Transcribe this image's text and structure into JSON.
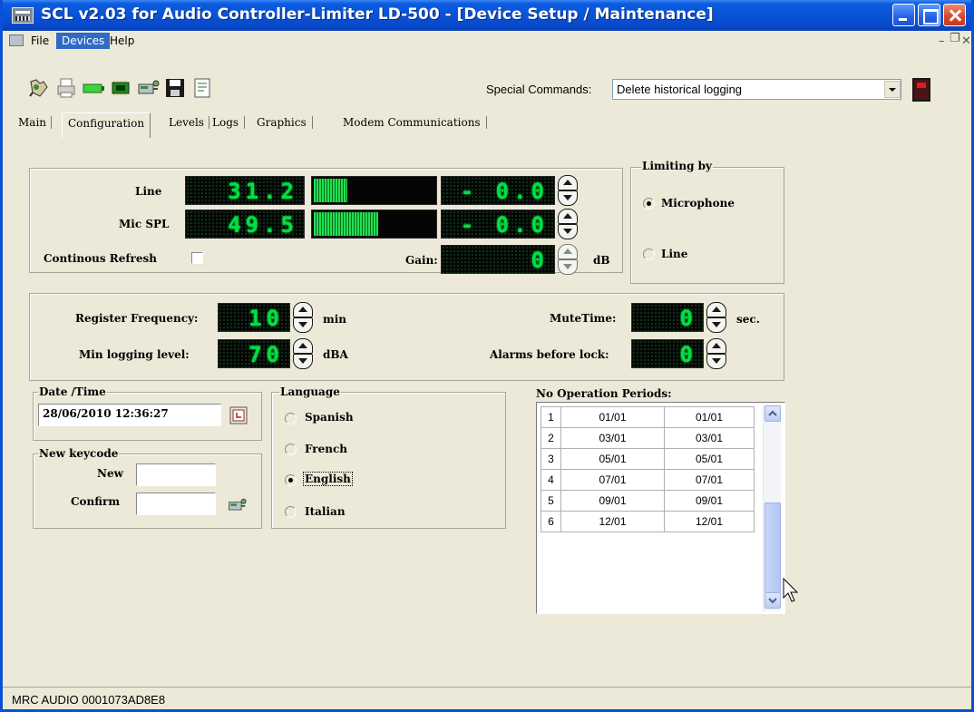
{
  "window": {
    "title": "SCL v2.03 for Audio Controller-Limiter LD-500 - [Device Setup / Maintenance]"
  },
  "menu": {
    "items": [
      "File",
      "Devices",
      "Help"
    ],
    "active": "Devices"
  },
  "toolbar": {
    "special_commands_label": "Special Commands:",
    "special_commands_value": "Delete historical logging",
    "icons": [
      "connect-icon",
      "print-icon",
      "battery-icon",
      "chip-icon",
      "device-icon",
      "save-icon",
      "document-icon"
    ]
  },
  "tabs": [
    "Main",
    "Configuration",
    "Levels",
    "Logs",
    "Graphics",
    "Modem Communications"
  ],
  "active_tab": "Configuration",
  "levels": {
    "line_label": "Line",
    "line_value": "31.2",
    "line_bar_fraction": 0.3,
    "line_offset": "- 0.0",
    "mic_label": "Mic SPL",
    "mic_value": "49.5",
    "mic_bar_fraction": 0.55,
    "mic_offset": "- 0.0",
    "refresh_label": "Continous Refresh",
    "refresh_checked": false,
    "gain_label": "Gain:",
    "gain_value": "0",
    "gain_unit": "dB"
  },
  "limiting": {
    "title": "Limiting by",
    "options": [
      "Microphone",
      "Line"
    ],
    "selected": "Microphone"
  },
  "logging": {
    "register_freq_label": "Register Frequency:",
    "register_freq_value": "10",
    "register_freq_unit": "min",
    "min_level_label": "Min logging level:",
    "min_level_value": "70",
    "min_level_unit": "dBA",
    "mute_time_label": "MuteTime:",
    "mute_time_value": "0",
    "mute_time_unit": "sec.",
    "alarms_label": "Alarms before lock:",
    "alarms_value": "0"
  },
  "datetime": {
    "title": "Date /Time",
    "value": "28/06/2010 12:36:27"
  },
  "keycode": {
    "title": "New keycode",
    "new_label": "New",
    "confirm_label": "Confirm"
  },
  "language": {
    "title": "Language",
    "options": [
      "Spanish",
      "French",
      "English",
      "Italian"
    ],
    "selected": "English"
  },
  "no_operation": {
    "title": "No Operation Periods:",
    "rows": [
      [
        "1",
        "01/01",
        "01/01"
      ],
      [
        "2",
        "03/01",
        "03/01"
      ],
      [
        "3",
        "05/01",
        "05/01"
      ],
      [
        "4",
        "07/01",
        "07/01"
      ],
      [
        "5",
        "09/01",
        "09/01"
      ],
      [
        "6",
        "12/01",
        "12/01"
      ]
    ]
  },
  "status": {
    "text": "MRC AUDIO 0001073AD8E8"
  },
  "colors": {
    "titlebar": "#0a52d6",
    "lcd_text": "#00e040",
    "menu_highlight": "#316ac5"
  }
}
